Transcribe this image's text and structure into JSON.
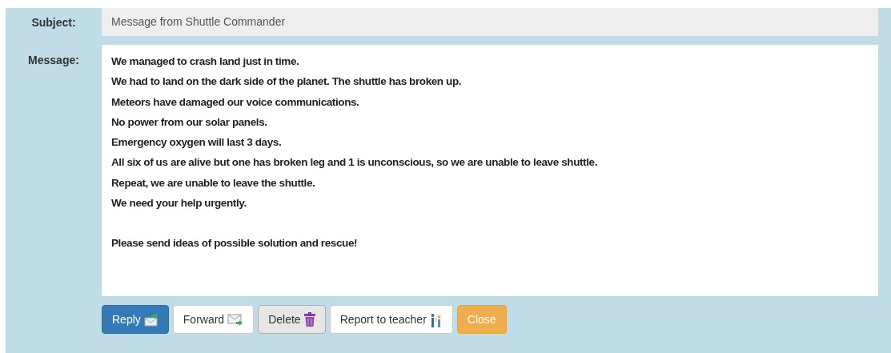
{
  "subject": {
    "label": "Subject:",
    "value": "Message from Shuttle Commander"
  },
  "message": {
    "label": "Message:",
    "paragraphs": [
      [
        "We managed to crash land just in time.",
        "We had to land on the dark side of the planet. The shuttle has broken up.",
        "Meteors have damaged our voice communications.",
        "No power from our solar panels.",
        "Emergency oxygen will last 3 days.",
        "All six of us are alive but one has broken leg and 1 is unconscious, so we are unable to leave shuttle.",
        "Repeat, we are unable to leave the shuttle.",
        "We need your help urgently."
      ],
      [
        "Please send ideas of possible solution and rescue!"
      ]
    ]
  },
  "buttons": [
    {
      "label": "Reply",
      "kind": "primary"
    },
    {
      "label": "Forward",
      "kind": "default"
    },
    {
      "label": "Delete",
      "kind": "pressed"
    },
    {
      "label": "Report to teacher",
      "kind": "default"
    },
    {
      "label": "Close",
      "kind": "warning"
    }
  ]
}
